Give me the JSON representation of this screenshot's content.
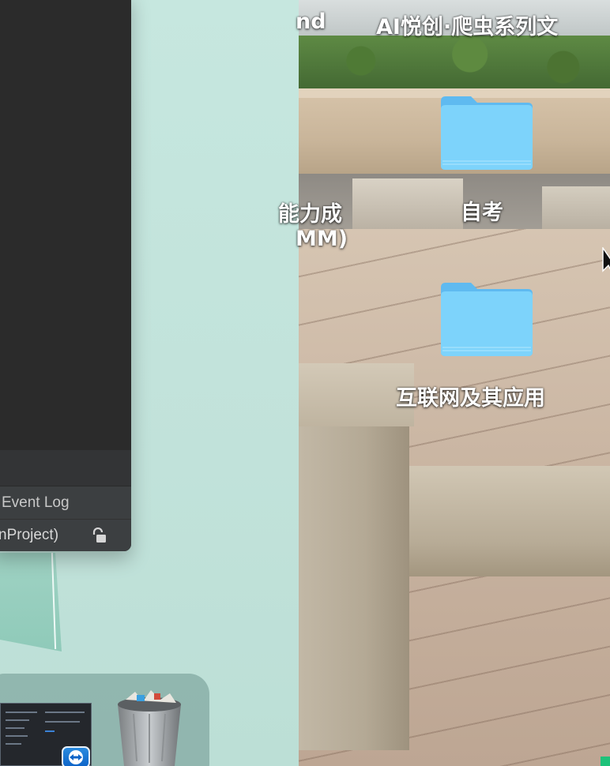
{
  "ide": {
    "event_log_label": "Event Log",
    "status_text": "nProject)"
  },
  "desktop": {
    "top_left_label": "nd",
    "top_right_label": "AI悦创·爬虫系列文",
    "partial_label_line1": "能力成",
    "partial_label_line2": "MM)",
    "folders": [
      {
        "label": "自考"
      },
      {
        "label": "互联网及其应用"
      }
    ]
  },
  "colors": {
    "folder_blue": "#6cc9f6",
    "mint_wallpaper": "#c4e5de",
    "ide_bg": "#2b2b2b"
  },
  "icons": [
    "lock-icon",
    "trash-icon",
    "teamviewer-icon",
    "folder-icon",
    "cursor-icon"
  ]
}
